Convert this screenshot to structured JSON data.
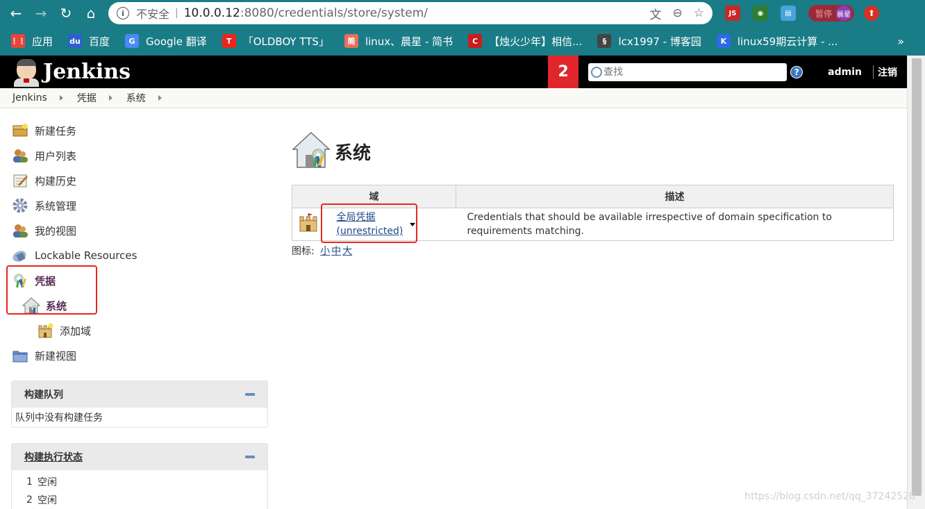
{
  "browser": {
    "security_label": "不安全",
    "url_host": "10.0.0.12",
    "url_path": ":8080/credentials/store/system/",
    "profile_label": "暂停",
    "profile_avatar": "晨星",
    "bookmarks": [
      {
        "label": "应用",
        "color": "#e8453c",
        "glyph": "⋮⋮"
      },
      {
        "label": "百度",
        "color": "#2e5fd1",
        "glyph": "du"
      },
      {
        "label": "Google 翻译",
        "color": "#4a8af4",
        "glyph": "G"
      },
      {
        "label": "「OLDBOY TTS」",
        "color": "#e8261c",
        "glyph": "T"
      },
      {
        "label": "linux、晨星 - 简书",
        "color": "#ea6f5a",
        "glyph": "简"
      },
      {
        "label": "【烛火少年】相信...",
        "color": "#c91c1c",
        "glyph": "C"
      },
      {
        "label": "lcx1997 - 博客园",
        "color": "#444444",
        "glyph": "§"
      },
      {
        "label": "linux59期云计算 - ...",
        "color": "#2b6ce4",
        "glyph": "K"
      }
    ]
  },
  "header": {
    "logo_text": "Jenkins",
    "notification_count": "2",
    "search_placeholder": "查找",
    "help_glyph": "?",
    "user": "admin",
    "logout": "注销"
  },
  "breadcrumb": [
    "Jenkins",
    "凭据",
    "系统"
  ],
  "sidebar": {
    "tasks": [
      {
        "label": "新建任务",
        "icon": "new-package-icon"
      },
      {
        "label": "用户列表",
        "icon": "users-icon"
      },
      {
        "label": "构建历史",
        "icon": "notepad-icon"
      },
      {
        "label": "系统管理",
        "icon": "gear-icon"
      },
      {
        "label": "我的视图",
        "icon": "user-icon"
      },
      {
        "label": "Lockable Resources",
        "icon": "lock-icon"
      },
      {
        "label": "凭据",
        "icon": "credentials-icon"
      },
      {
        "label": "系统",
        "icon": "system-store-icon"
      },
      {
        "label": "添加域",
        "icon": "castle-icon"
      },
      {
        "label": "新建视图",
        "icon": "folder-icon"
      }
    ],
    "queue": {
      "title": "构建队列",
      "empty_text": "队列中没有构建任务"
    },
    "executors": {
      "title": "构建执行状态",
      "rows": [
        {
          "num": "1",
          "status": "空闲"
        },
        {
          "num": "2",
          "status": "空闲"
        }
      ]
    }
  },
  "main": {
    "title": "系统",
    "table": {
      "col_domain": "域",
      "col_desc": "描述",
      "rows": [
        {
          "domain_name": "全局凭据",
          "domain_sub": "(unrestricted)",
          "description": "Credentials that should be available irrespective of domain specification to requirements matching."
        }
      ]
    },
    "icon_size_label": "图标:",
    "icon_sizes": [
      "小",
      "中",
      "大"
    ]
  },
  "watermark": "https://blog.csdn.net/qq_37242520",
  "colors": {
    "chrome": "#1a7c86",
    "jenkins_header": "#000000",
    "badge": "#e0262a",
    "annotation": "#e8261c",
    "link": "#204a87"
  }
}
